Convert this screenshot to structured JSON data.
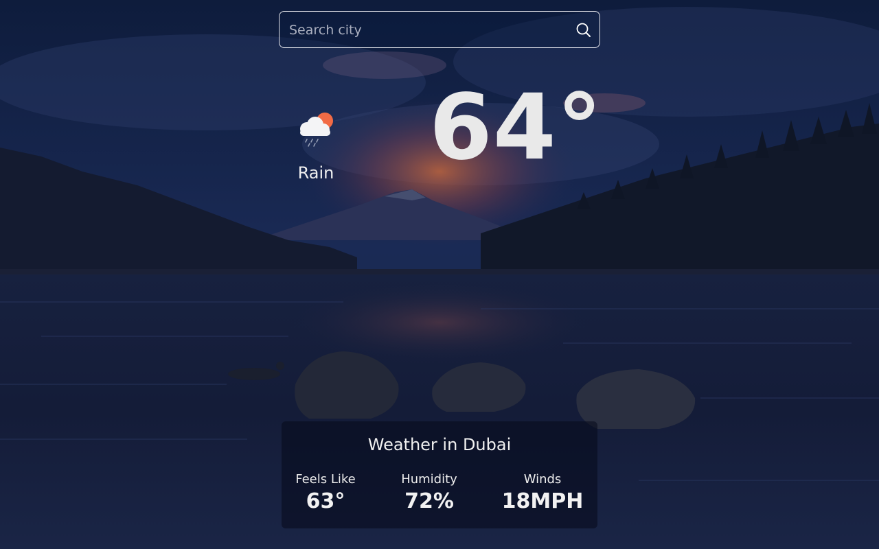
{
  "search": {
    "placeholder": "Search city",
    "value": ""
  },
  "current": {
    "condition": "Rain",
    "condition_icon": "cloud-sun-rain-icon",
    "temperature": "64°"
  },
  "details": {
    "title": "Weather in Dubai",
    "feels_like": {
      "label": "Feels Like",
      "value": "63°"
    },
    "humidity": {
      "label": "Humidity",
      "value": "72%"
    },
    "winds": {
      "label": "Winds",
      "value": "18MPH"
    }
  },
  "colors": {
    "sky_top": "#0f1e3e",
    "sky_bottom": "#1c2a52",
    "sunset_glow": "#b15a3a",
    "sun_icon": "#f26b45",
    "water": "#121a34",
    "text": "#f2f2f2"
  }
}
